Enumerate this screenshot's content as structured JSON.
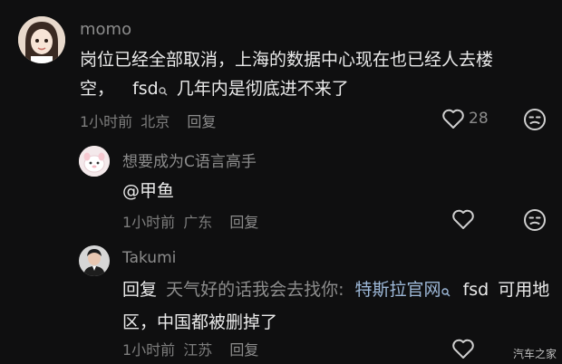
{
  "comments": [
    {
      "username": "momo",
      "text_line1": "岗位已经全部取消，上海的数据中心现在也已经人去楼",
      "text_line2_prefix": "空，",
      "text_search_term": "fsd",
      "text_line2_suffix": "几年内是彻底进不来了",
      "time": "1小时前",
      "location": "北京",
      "reply_label": "回复",
      "like_count": "28"
    },
    {
      "username": "想要成为C语言高手",
      "text": "@甲鱼",
      "time": "1小时前",
      "location": "广东",
      "reply_label": "回复"
    },
    {
      "username": "Takumi",
      "reply_prefix": "回复",
      "reply_to": "天气好的话我会去找你:",
      "link_text": "特斯拉官网",
      "search_term": "fsd",
      "text_line1_suffix": "可用地",
      "text_line2": "区，中国都被删掉了",
      "time": "1小时前",
      "location": "江苏",
      "reply_label": "回复"
    }
  ],
  "watermark": "汽车之家"
}
